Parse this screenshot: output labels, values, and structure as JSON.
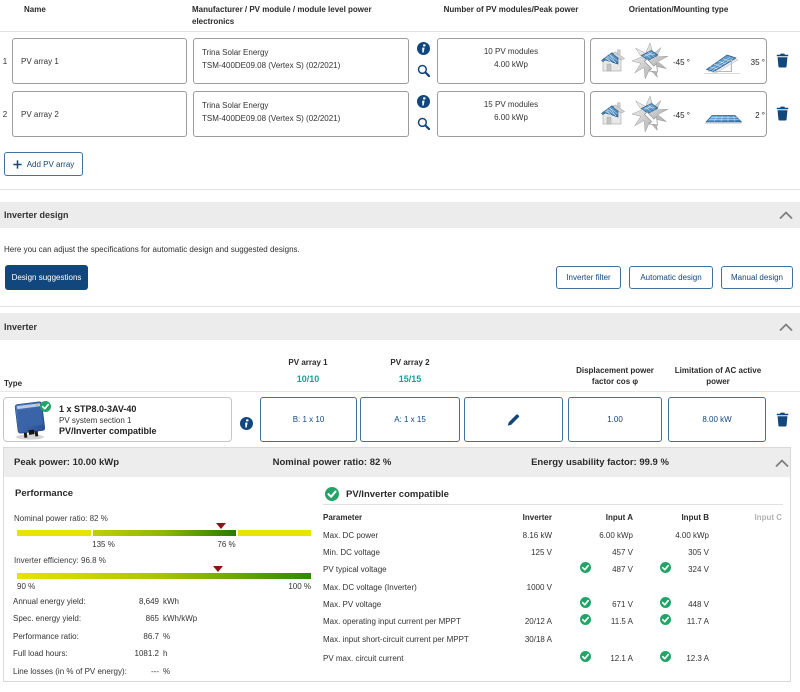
{
  "colors": {
    "primary_navy": "#11477c",
    "teal": "#17a093",
    "check_green": "#21a467",
    "band_gray": "#ececec",
    "marker_red": "#8e1117",
    "bar_yellow": "#e8e400",
    "bar_green_dark": "#237c00"
  },
  "array_table": {
    "headers": {
      "name": "Name",
      "manufacturer": "Manufacturer / PV module / module level power electronics",
      "modules": "Number of PV modules/Peak power",
      "orientation": "Orientation/Mounting type"
    },
    "rows": [
      {
        "index": "1",
        "name": "PV array 1",
        "manufacturer": "Trina Solar Energy",
        "module": "TSM-400DE09.08 (Vertex S) (02/2021)",
        "modules_count": "10 PV modules",
        "peak_power": "4.00 kWp",
        "azimuth": "-45 °",
        "tilt": "35 °"
      },
      {
        "index": "2",
        "name": "PV array 2",
        "manufacturer": "Trina Solar Energy",
        "module": "TSM-400DE09.08 (Vertex S) (02/2021)",
        "modules_count": "15 PV modules",
        "peak_power": "6.00 kWp",
        "azimuth": "-45 °",
        "tilt": "2 °"
      }
    ],
    "add_button": "Add PV array"
  },
  "inverter_design": {
    "title": "Inverter design",
    "description": "Here you can adjust the specifications for automatic design and suggested designs.",
    "primary_button": "Design suggestions",
    "buttons": [
      "Inverter filter",
      "Automatic design",
      "Manual design"
    ]
  },
  "inverter": {
    "title": "Inverter",
    "col_type": "Type",
    "col_pv1": "PV array 1",
    "col_pv1_sub": "10/10",
    "col_pv2": "PV array 2",
    "col_pv2_sub": "15/15",
    "col_cos_1": "Displacement power",
    "col_cos_2": "factor cos φ",
    "col_limit_1": "Limitation of AC active",
    "col_limit_2": "power",
    "row": {
      "title": "1 x STP8.0-3AV-40",
      "subtitle": "PV system section 1",
      "status": "PV/Inverter compatible",
      "config_b": "B: 1 x 10",
      "config_a": "A: 1 x 15",
      "cos_value": "1.00",
      "limit_value": "8.00 kW"
    }
  },
  "results": {
    "peak_power": "Peak power: 10.00 kWp",
    "nominal_ratio": "Nominal power ratio: 82 %",
    "usability": "Energy usability factor: 99.9 %",
    "performance": {
      "title": "Performance",
      "bar1_label": "Nominal power ratio: 82 %",
      "bar1_tick1": "135 %",
      "bar1_tick2": "76 %",
      "bar2_label": "Inverter efficiency: 96.8 %",
      "bar2_tick1": "90 %",
      "bar2_tick2": "100 %",
      "stats": [
        {
          "label": "Annual energy yield:",
          "num": "8,649",
          "unit": "kWh"
        },
        {
          "label": "Spec. energy yield:",
          "num": "865",
          "unit": "kWh/kWp"
        },
        {
          "label": "Performance ratio:",
          "num": "86.7",
          "unit": "%"
        },
        {
          "label": "Full load hours:",
          "num": "1081.2",
          "unit": "h"
        },
        {
          "label": "Line losses (in % of PV energy):",
          "num": "---",
          "unit": "%"
        }
      ]
    },
    "compat": {
      "title": "PV/Inverter compatible",
      "headers": {
        "param": "Parameter",
        "inverter": "Inverter",
        "a": "Input A",
        "b": "Input B",
        "c": "Input C"
      },
      "rows": [
        {
          "param": "Max. DC power",
          "inverter": "8.16 kW",
          "a": "6.00 kWp",
          "b": "4.00 kWp"
        },
        {
          "param": "Min. DC voltage",
          "inverter": "125 V",
          "a": "457 V",
          "b": "305 V"
        },
        {
          "param": "PV typical voltage",
          "inverter": "",
          "a": "487 V",
          "b": "324 V"
        },
        {
          "param": "Max. DC voltage (Inverter)",
          "inverter": "1000 V",
          "a": "",
          "b": ""
        },
        {
          "param": "Max. PV voltage",
          "inverter": "",
          "a": "671 V",
          "b": "448 V"
        },
        {
          "param": "Max. operating input current per MPPT",
          "inverter": "20/12 A",
          "a": "11.5 A",
          "b": "11.7 A"
        },
        {
          "param": "Max. input short-circuit current per MPPT",
          "inverter": "30/18 A",
          "a": "",
          "b": ""
        },
        {
          "param": "PV max. circuit current",
          "inverter": "",
          "a": "12.1 A",
          "b": "12.3 A"
        }
      ]
    }
  }
}
